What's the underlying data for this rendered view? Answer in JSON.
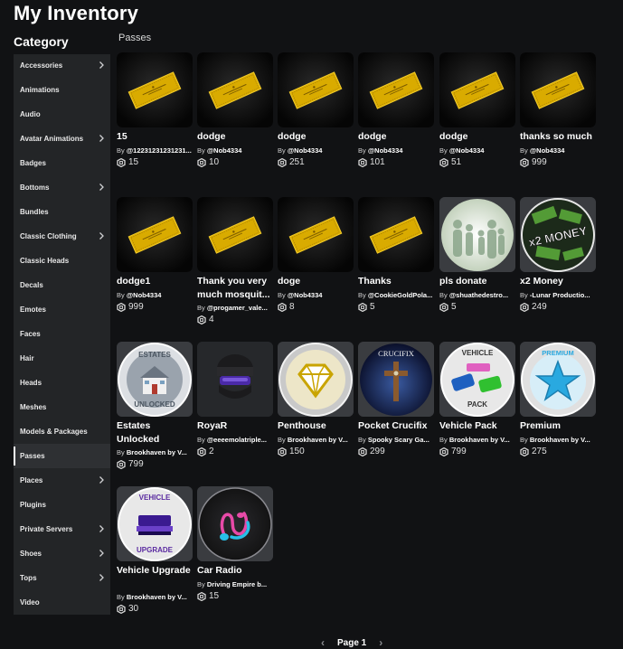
{
  "header": {
    "title": "My Inventory"
  },
  "sidebar": {
    "heading": "Category",
    "items": [
      {
        "label": "Accessories",
        "chevron": true
      },
      {
        "label": "Animations",
        "chevron": false
      },
      {
        "label": "Audio",
        "chevron": false
      },
      {
        "label": "Avatar Animations",
        "chevron": true
      },
      {
        "label": "Badges",
        "chevron": false
      },
      {
        "label": "Bottoms",
        "chevron": true
      },
      {
        "label": "Bundles",
        "chevron": false
      },
      {
        "label": "Classic Clothing",
        "chevron": true
      },
      {
        "label": "Classic Heads",
        "chevron": false
      },
      {
        "label": "Decals",
        "chevron": false
      },
      {
        "label": "Emotes",
        "chevron": false
      },
      {
        "label": "Faces",
        "chevron": false
      },
      {
        "label": "Hair",
        "chevron": false
      },
      {
        "label": "Heads",
        "chevron": false
      },
      {
        "label": "Meshes",
        "chevron": false
      },
      {
        "label": "Models & Packages",
        "chevron": false
      },
      {
        "label": "Passes",
        "chevron": false,
        "active": true
      },
      {
        "label": "Places",
        "chevron": true
      },
      {
        "label": "Plugins",
        "chevron": false
      },
      {
        "label": "Private Servers",
        "chevron": true
      },
      {
        "label": "Shoes",
        "chevron": true
      },
      {
        "label": "Tops",
        "chevron": true
      },
      {
        "label": "Video",
        "chevron": false
      }
    ]
  },
  "main": {
    "section_label": "Passes",
    "by_prefix": "By",
    "items": [
      {
        "name": "15",
        "creator": "@12231231231231...",
        "price": "15",
        "thumb": "ticket"
      },
      {
        "name": "dodge",
        "creator": "@Nob4334",
        "price": "10",
        "thumb": "ticket"
      },
      {
        "name": "dodge",
        "creator": "@Nob4334",
        "price": "251",
        "thumb": "ticket"
      },
      {
        "name": "dodge",
        "creator": "@Nob4334",
        "price": "101",
        "thumb": "ticket"
      },
      {
        "name": "dodge",
        "creator": "@Nob4334",
        "price": "51",
        "thumb": "ticket"
      },
      {
        "name": "thanks so much",
        "creator": "@Nob4334",
        "price": "999",
        "thumb": "ticket"
      },
      {
        "name": "dodge1",
        "creator": "@Nob4334",
        "price": "999",
        "thumb": "ticket"
      },
      {
        "name": "Thank you very much mosquit...",
        "creator": "@progamer_vale...",
        "price": "4",
        "thumb": "ticket",
        "two_line": true
      },
      {
        "name": "doge",
        "creator": "@Nob4334",
        "price": "8",
        "thumb": "ticket"
      },
      {
        "name": "Thanks",
        "creator": "@CookieGoldPola...",
        "price": "5",
        "thumb": "ticket"
      },
      {
        "name": "pls donate",
        "creator": "@shuathedestro...",
        "price": "5",
        "thumb": "family"
      },
      {
        "name": "x2 Money",
        "creator": "-Lunar Productio...",
        "price": "249",
        "thumb": "money",
        "thumb_text": "x2 MONEY"
      },
      {
        "name": "Estates Unlocked",
        "creator": "Brookhaven by V...",
        "price": "799",
        "thumb": "estates",
        "two_line": true,
        "thumb_text_top": "ESTATES",
        "thumb_text_bottom": "UNLOCKED"
      },
      {
        "name": "RoyaR",
        "creator": "@eeeemolatriple...",
        "price": "2",
        "thumb": "helmet"
      },
      {
        "name": "Penthouse",
        "creator": "Brookhaven by V...",
        "price": "150",
        "thumb": "diamond"
      },
      {
        "name": "Pocket Crucifix",
        "creator": "Spooky Scary Ga...",
        "price": "299",
        "thumb": "crucifix",
        "thumb_text": "CRUCIFIX"
      },
      {
        "name": "Vehicle Pack",
        "creator": "Brookhaven by V...",
        "price": "799",
        "thumb": "vehicle",
        "thumb_text_top": "VEHICLE",
        "thumb_text_bottom": "PACK"
      },
      {
        "name": "Premium",
        "creator": "Brookhaven by V...",
        "price": "275",
        "thumb": "premium",
        "thumb_text": "PREMIUM"
      },
      {
        "name": "Vehicle Upgrade",
        "creator": "Brookhaven by V...",
        "price": "30",
        "thumb": "upgrade",
        "two_line": true,
        "thumb_text_top": "VEHICLE",
        "thumb_text_bottom": "UPGRADE"
      },
      {
        "name": "Car Radio",
        "creator": "Driving Empire b...",
        "price": "15",
        "thumb": "radio"
      }
    ]
  },
  "pagination": {
    "label": "Page 1"
  },
  "colors": {
    "background": "#111214",
    "sidebar": "#232527",
    "ticket": "#e2b400",
    "premium": "#29a9e0"
  }
}
